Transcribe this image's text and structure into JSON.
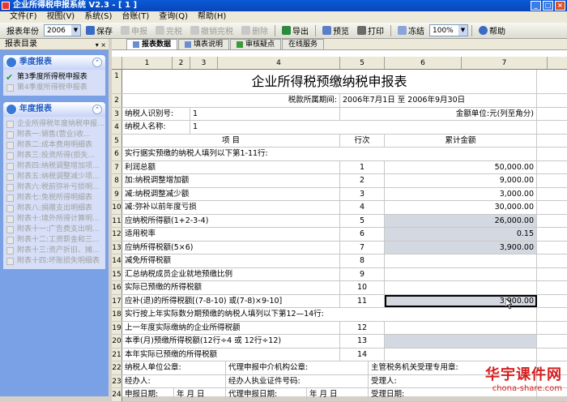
{
  "window": {
    "title": "企业所得税申报系统  V2.3 - [ 1 ]"
  },
  "menu": [
    "文件(F)",
    "视图(V)",
    "系统(S)",
    "台账(T)",
    "查询(Q)",
    "帮助(H)"
  ],
  "toolbar": {
    "year_label": "报表年份",
    "year_value": "2006",
    "save": "保存",
    "declare": "申报",
    "complete": "完税",
    "cancel_complete": "撤销完税",
    "delete": "删除",
    "export": "导出",
    "preview": "预览",
    "print": "打印",
    "freeze": "冻结",
    "zoom": "100%",
    "help": "帮助"
  },
  "sidebar": {
    "header": "报表目录",
    "quarter_group": "季度报表",
    "quarter_items": [
      "第3季度所得税申报表",
      "第4季度所得税申报表"
    ],
    "annual_group": "年度报表",
    "annual_items": [
      "企业所得税年度纳税申报...",
      "附表一:销售(营业)收...",
      "附表二:成本费用明细表",
      "附表三:投资所得(损失...",
      "附表四:纳税调整增加项...",
      "附表五:纳税调整减少项...",
      "附表六:税前弥补亏损明...",
      "附表七:免税所得明细表",
      "附表八:捐赠支出明细表",
      "附表十:境外所得计算明...",
      "附表十一:广告费支出明...",
      "附表十二:工资薪金和三...",
      "附表十三:资产折旧、摊...",
      "附表十四:坏账损失明细表"
    ]
  },
  "tabs": [
    "报表数据",
    "填表说明",
    "审核疑点",
    "在线服务"
  ],
  "grid": {
    "columns": [
      "1",
      "2",
      "3",
      "4",
      "5",
      "6",
      "7"
    ],
    "title": "企业所得税预缴纳税申报表",
    "period_label": "税款所属期间:",
    "period_value": "2006年7月1日  至  2006年9月30日",
    "taxpayer_id_label": "纳税人识别号:",
    "taxpayer_id_value": "1",
    "unit": "金额单位:元(列至角分)",
    "taxpayer_name_label": "纳税人名称:",
    "taxpayer_name_value": "1",
    "head_item": "项    目",
    "head_line": "行次",
    "head_amount": "累计金额",
    "section1": "实行据实预缴的纳税人填列以下第1-11行:",
    "lines": [
      {
        "label": "利润总额",
        "line": "1",
        "amount": "50,000.00"
      },
      {
        "label": "加:纳税调整增加额",
        "line": "2",
        "amount": "9,000.00"
      },
      {
        "label": "减:纳税调整减少额",
        "line": "3",
        "amount": "3,000.00"
      },
      {
        "label": "减:弥补以前年度亏损",
        "line": "4",
        "amount": "30,000.00"
      },
      {
        "label": "应纳税所得额(1+2-3-4)",
        "line": "5",
        "amount": "26,000.00"
      },
      {
        "label": "适用税率",
        "line": "6",
        "amount": "0.15"
      },
      {
        "label": "应纳所得税额(5×6)",
        "line": "7",
        "amount": "3,900.00"
      },
      {
        "label": "减免所得税额",
        "line": "8",
        "amount": ""
      },
      {
        "label": "汇总纳税成员企业就地预缴比例",
        "line": "9",
        "amount": ""
      },
      {
        "label": "实际已预缴的所得税额",
        "line": "10",
        "amount": ""
      },
      {
        "label": "应补(退)的所得税额[(7-8-10) 或(7-8)×9-10]",
        "line": "11",
        "amount": "3,900.00"
      }
    ],
    "section2": "实行按上年实际数分期预缴的纳税人填列以下第12—14行:",
    "lines2": [
      {
        "label": "上一年度实际缴纳的企业所得税额",
        "line": "12",
        "amount": ""
      },
      {
        "label": "本季(月)预缴所得税额(12行÷4 或 12行÷12)",
        "line": "13",
        "amount": ""
      },
      {
        "label": "本年实际已预缴的所得税额",
        "line": "14",
        "amount": ""
      }
    ],
    "seal_taxpayer": "纳税人单位公章:",
    "seal_agent": "代理申报中介机构公章:",
    "seal_authority": "主管税务机关受理专用章:",
    "operator": "经办人:",
    "agent_license": "经办人执业证件号码:",
    "receiver": "受理人:",
    "date_declare": "申报日期:",
    "date_agent": "代理申报日期:",
    "date_receive": "受理日期:",
    "ymd": "年   月   日"
  },
  "watermark": {
    "line1": "华宇课件网",
    "line2": "chona-share.com"
  }
}
